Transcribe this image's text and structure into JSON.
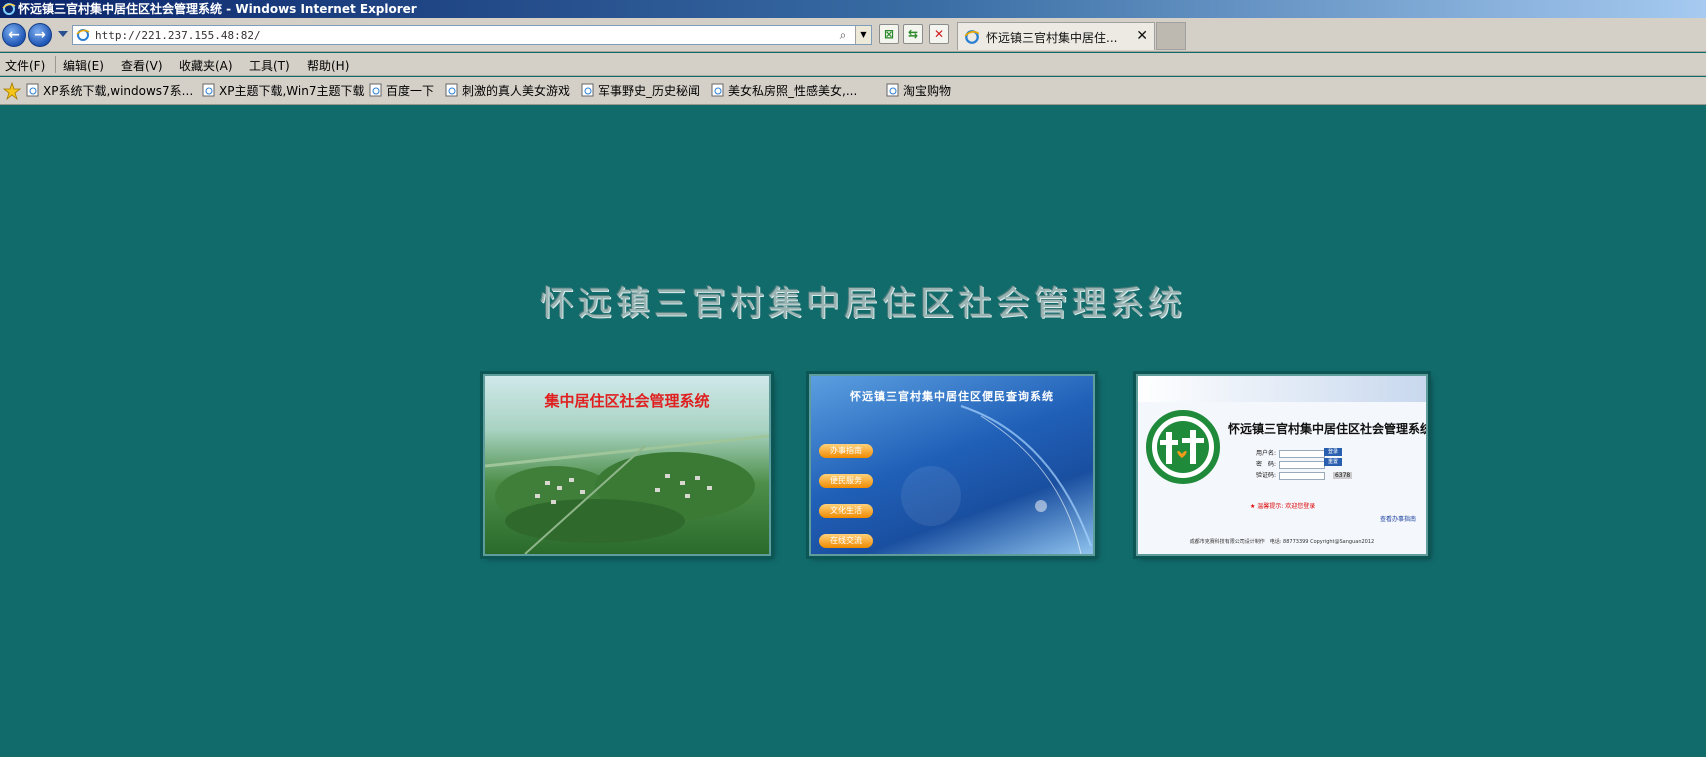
{
  "window": {
    "title": "怀远镇三官村集中居住区社会管理系统 - Windows Internet Explorer"
  },
  "address_bar": {
    "url": "http://221.237.155.48:82/"
  },
  "tab": {
    "label": "怀远镇三官村集中居住..."
  },
  "menu": [
    {
      "label": "文件(F)"
    },
    {
      "label": "编辑(E)"
    },
    {
      "label": "查看(V)"
    },
    {
      "label": "收藏夹(A)"
    },
    {
      "label": "工具(T)"
    },
    {
      "label": "帮助(H)"
    }
  ],
  "favorites": [
    {
      "label": "XP系统下载,windows7系..."
    },
    {
      "label": "XP主题下载,Win7主题下载"
    },
    {
      "label": "百度一下"
    },
    {
      "label": "刺激的真人美女游戏"
    },
    {
      "label": "军事野史_历史秘闻"
    },
    {
      "label": "美女私房照_性感美女,..."
    },
    {
      "label": "淘宝购物"
    }
  ],
  "page": {
    "title": "怀远镇三官村集中居住区社会管理系统",
    "cards": [
      {
        "title": "集中居住区社会管理系统"
      },
      {
        "title": "怀远镇三官村集中居住区便民查询系统",
        "buttons": [
          "办事指南",
          "便民服务",
          "文化生活",
          "在线交流"
        ]
      },
      {
        "title": "怀远镇三官村集中居住区社会管理系统",
        "user_label": "用户名:",
        "pass_label": "密　码:",
        "code_label": "验证码:",
        "login_btn": "登录",
        "reset_btn": "重置",
        "code_value": "6378",
        "tip": "★ 温馨提示: 欢迎您登录",
        "guide": "查看办事指南",
        "copyright": "成都市克赛科技有限公司设计制作　电话: 88773399 Copyright@Sanguan2012"
      }
    ]
  }
}
